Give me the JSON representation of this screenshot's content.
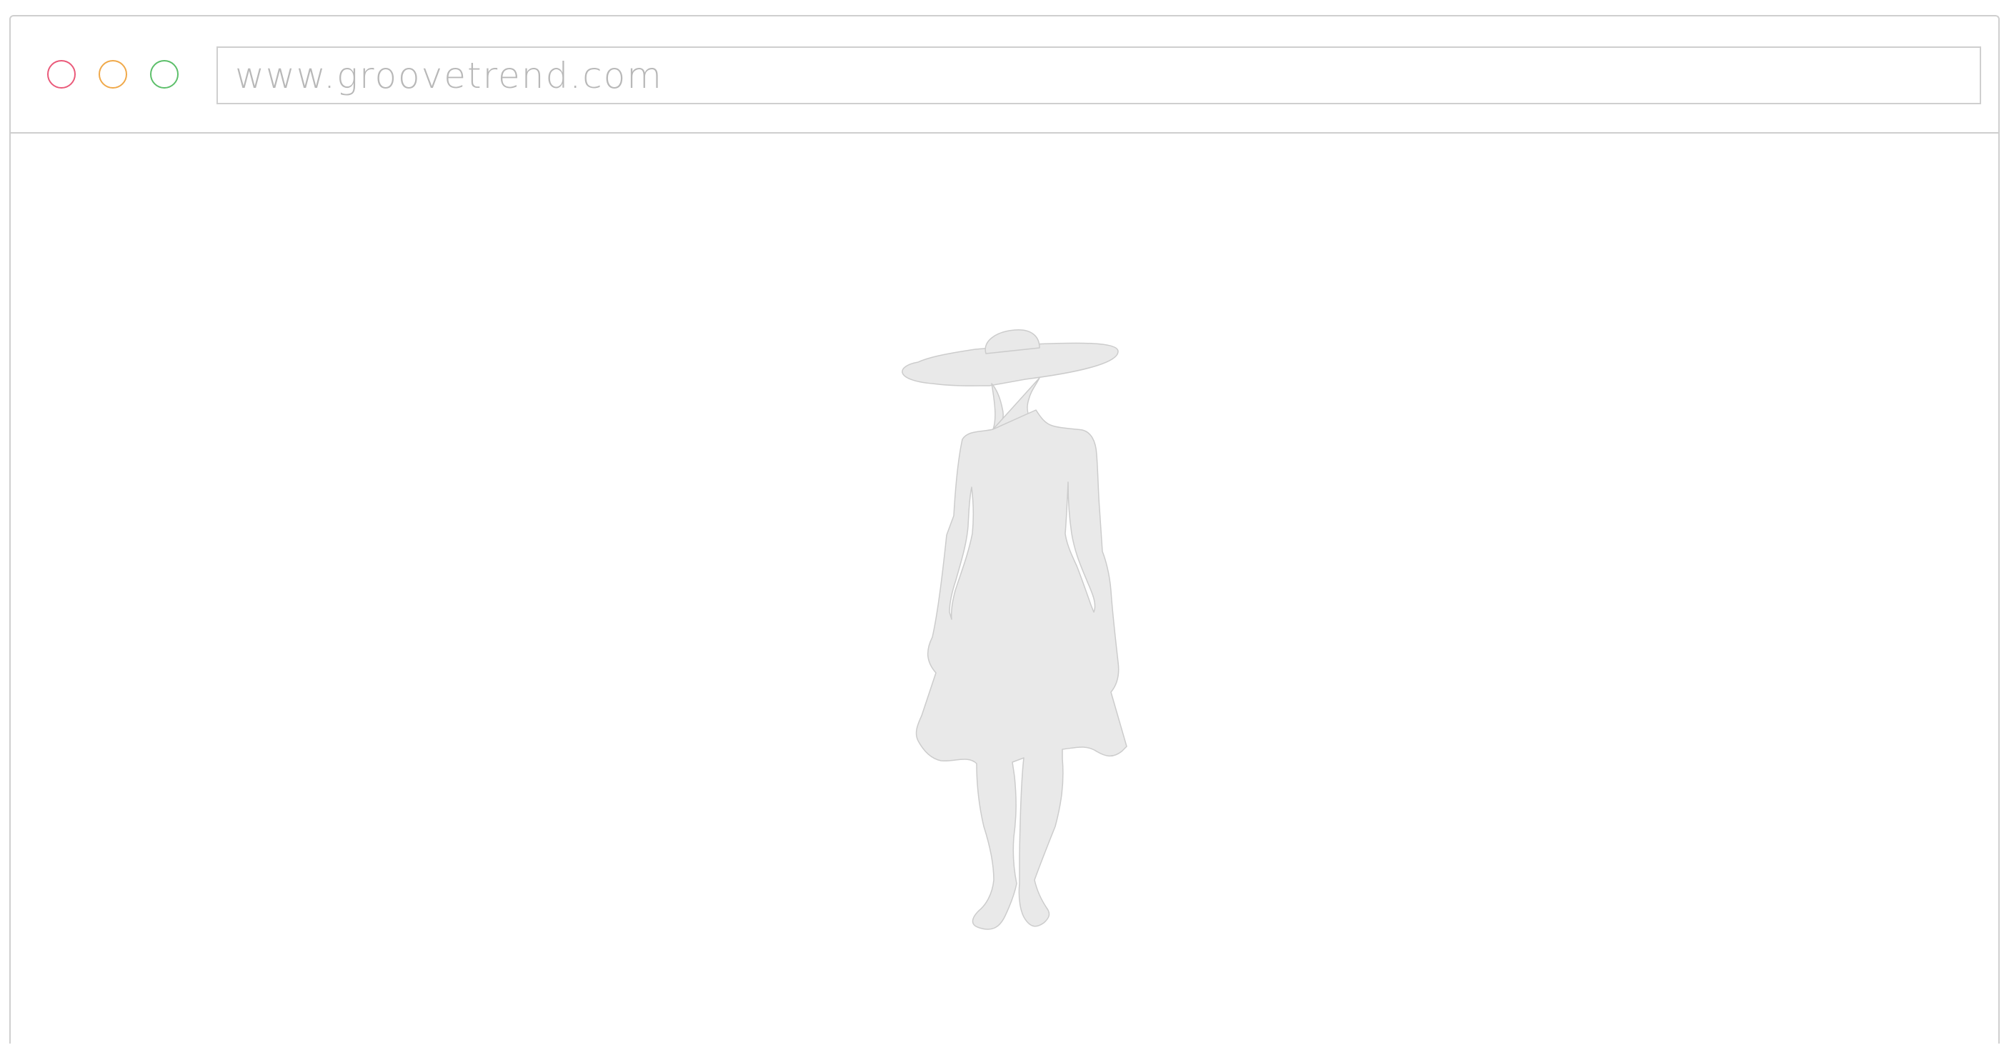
{
  "browser": {
    "url": "www.groovetrend.com"
  },
  "icons": {
    "close": "close-dot-icon",
    "minimize": "minimize-dot-icon",
    "maximize": "maximize-dot-icon",
    "figure": "woman-silhouette-icon"
  },
  "colors": {
    "close": "#ea5a7a",
    "minimize": "#f0a94a",
    "maximize": "#5cbf6a",
    "frame": "#cfcfcf",
    "url_text": "#b8b8b8",
    "silhouette_fill": "#e9e9e9",
    "silhouette_stroke": "#cccccc"
  }
}
